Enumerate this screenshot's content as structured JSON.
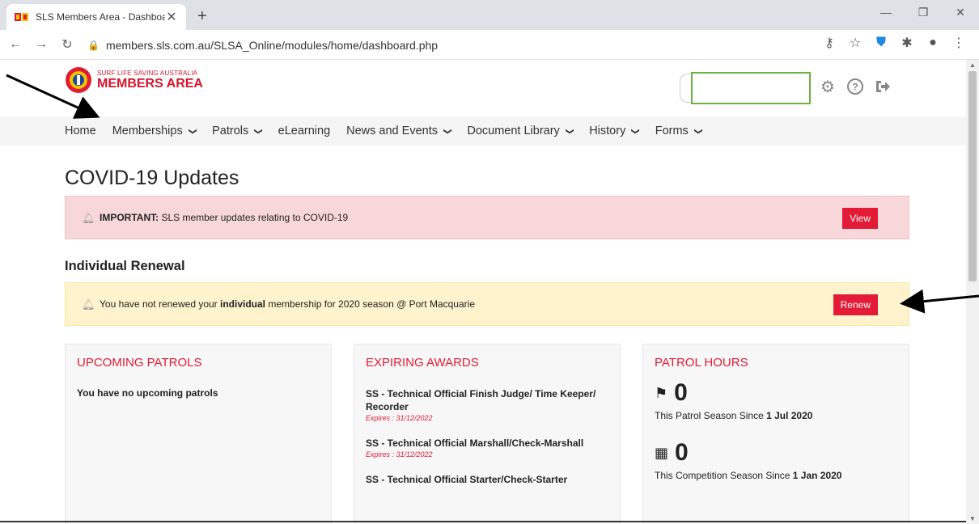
{
  "browser": {
    "tab_title": "SLS Members Area - Dashboard",
    "tab_close": "✕",
    "new_tab": "+",
    "url": "members.sls.com.au/SLSA_Online/modules/home/dashboard.php"
  },
  "header": {
    "logo_small": "SURF LIFE SAVING AUSTRALIA",
    "logo_big": "MEMBERS AREA",
    "search_value": ""
  },
  "nav": {
    "items": [
      {
        "label": "Home",
        "chevron": false
      },
      {
        "label": "Memberships",
        "chevron": true
      },
      {
        "label": "Patrols",
        "chevron": true
      },
      {
        "label": "eLearning",
        "chevron": false
      },
      {
        "label": "News and Events",
        "chevron": true
      },
      {
        "label": "Document Library",
        "chevron": true
      },
      {
        "label": "History",
        "chevron": true
      },
      {
        "label": "Forms",
        "chevron": true
      }
    ]
  },
  "main": {
    "heading": "COVID-19 Updates",
    "covid_alert": {
      "strong": "IMPORTANT:",
      "text": " SLS member updates relating to COVID-19",
      "button": "View"
    },
    "renewal_heading": "Individual Renewal",
    "renew_alert": {
      "pre": "You have not renewed your ",
      "strong": "individual",
      "post": " membership for 2020 season @ Port Macquarie",
      "button": "Renew"
    }
  },
  "cards": {
    "patrols": {
      "title": "UPCOMING PATROLS",
      "text": "You have no upcoming patrols"
    },
    "awards": {
      "title": "EXPIRING AWARDS",
      "items": [
        {
          "name": "SS - Technical Official Finish Judge/ Time Keeper/ Recorder",
          "expires": "Expires : 31/12/2022"
        },
        {
          "name": "SS - Technical Official Marshall/Check-Marshall",
          "expires": "Expires : 31/12/2022"
        },
        {
          "name": "SS - Technical Official Starter/Check-Starter",
          "expires": ""
        }
      ]
    },
    "hours": {
      "title": "PATROL HOURS",
      "patrol_value": "0",
      "patrol_label": "This Patrol Season Since ",
      "patrol_since": "1 Jul 2020",
      "comp_value": "0",
      "comp_label": "This Competition Season Since ",
      "comp_since": "1 Jan 2020"
    }
  },
  "colors": {
    "brand_red": "#e31b36",
    "search_border": "#6cb33f",
    "covid_bg": "#f8d7da",
    "renew_bg": "#fff3cd"
  }
}
